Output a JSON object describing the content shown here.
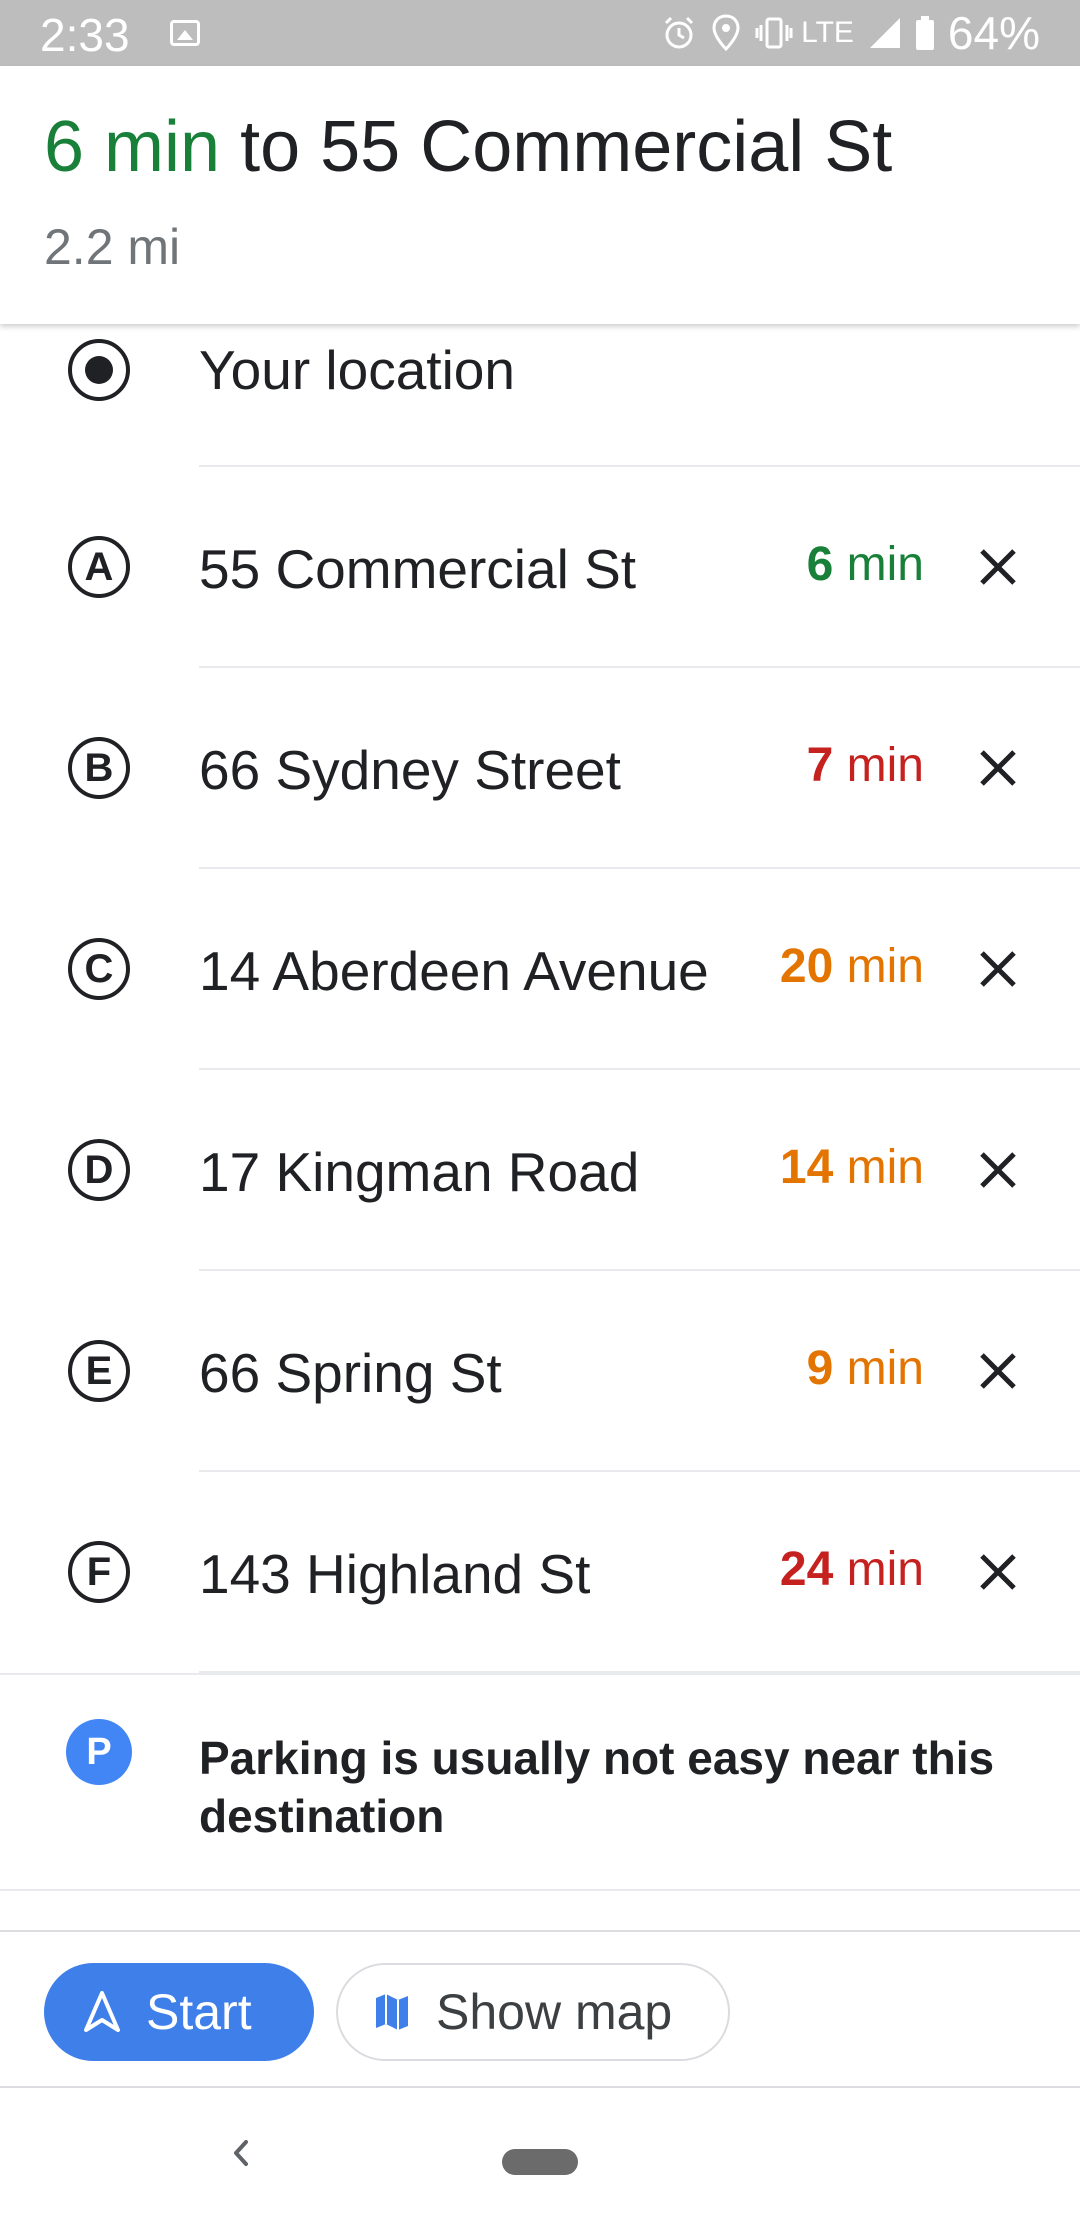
{
  "status_bar": {
    "time": "2:33",
    "network": "LTE",
    "battery": "64%"
  },
  "header": {
    "duration": "6 min",
    "destination": "to 55 Commercial St",
    "distance": "2.2 mi"
  },
  "origin": {
    "label": "Your location"
  },
  "stops": [
    {
      "letter": "A",
      "label": "55 Commercial St",
      "duration_value": "6",
      "duration_unit": "min",
      "color": "#188038"
    },
    {
      "letter": "B",
      "label": "66 Sydney Street",
      "duration_value": "7",
      "duration_unit": "min",
      "color": "#c5221f"
    },
    {
      "letter": "C",
      "label": "14 Aberdeen Avenue",
      "duration_value": "20",
      "duration_unit": "min",
      "color": "#e37400"
    },
    {
      "letter": "D",
      "label": "17 Kingman Road",
      "duration_value": "14",
      "duration_unit": "min",
      "color": "#e37400"
    },
    {
      "letter": "E",
      "label": "66 Spring St",
      "duration_value": "9",
      "duration_unit": "min",
      "color": "#e37400"
    },
    {
      "letter": "F",
      "label": "143 Highland St",
      "duration_value": "24",
      "duration_unit": "min",
      "color": "#c5221f"
    }
  ],
  "parking": {
    "icon_letter": "P",
    "text": "Parking is usually not easy near this destination"
  },
  "actions": {
    "start_label": "Start",
    "show_map_label": "Show map"
  },
  "colors": {
    "accent": "#3f7fe9",
    "fast": "#188038",
    "moderate": "#e37400",
    "slow": "#c5221f"
  }
}
